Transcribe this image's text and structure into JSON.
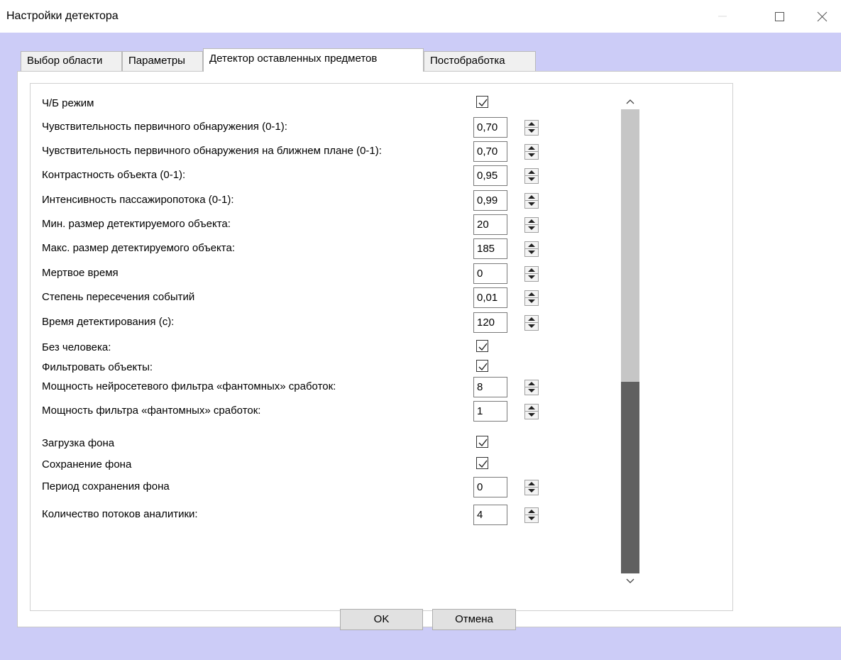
{
  "window": {
    "title": "Настройки детектора"
  },
  "tabs": [
    {
      "label": "Выбор области"
    },
    {
      "label": "Параметры"
    },
    {
      "label": "Детектор оставленных предметов",
      "active": true
    },
    {
      "label": "Постобработка"
    }
  ],
  "params": [
    {
      "label": "Ч/Б режим",
      "type": "checkbox",
      "checked": true
    },
    {
      "label": "Чувствительность первичного обнаружения (0-1):",
      "type": "number",
      "value": "0,70"
    },
    {
      "label": "Чувствительность первичного обнаружения на ближнем плане (0-1):",
      "type": "number",
      "value": "0,70"
    },
    {
      "label": "Контрастность объекта (0-1):",
      "type": "number",
      "value": "0,95"
    },
    {
      "label": "Интенсивность пассажиропотока (0-1):",
      "type": "number",
      "value": "0,99"
    },
    {
      "label": "Мин. размер детектируемого объекта:",
      "type": "number",
      "value": "20"
    },
    {
      "label": "Макс. размер детектируемого объекта:",
      "type": "number",
      "value": "185"
    },
    {
      "label": "Мертвое время",
      "type": "number",
      "value": "0"
    },
    {
      "label": "Степень пересечения событий",
      "type": "number",
      "value": "0,01"
    },
    {
      "label": "Время детектирования (с):",
      "type": "number",
      "value": "120"
    },
    {
      "label": "Без человека:",
      "type": "checkbox",
      "checked": true
    },
    {
      "label": "Фильтровать объекты:",
      "type": "checkbox",
      "checked": true
    },
    {
      "label": "Мощность нейросетевого фильтра «фантомных» сработок:",
      "type": "number",
      "value": "8"
    },
    {
      "label": "Мощность фильтра «фантомных» сработок:",
      "type": "number",
      "value": "1"
    },
    {
      "label": "Загрузка фона",
      "type": "checkbox",
      "checked": true
    },
    {
      "label": "Сохранение фона",
      "type": "checkbox",
      "checked": true
    },
    {
      "label": "Период сохранения фона",
      "type": "number",
      "value": "0"
    },
    {
      "label": "Количество потоков аналитики:",
      "type": "number",
      "value": "4"
    }
  ],
  "buttons": {
    "ok": "OK",
    "cancel": "Отмена"
  },
  "colors": {
    "dialog_background": "#ccccf7",
    "scroll_thumb": "#606060",
    "scroll_track": "#c6c6c6"
  }
}
